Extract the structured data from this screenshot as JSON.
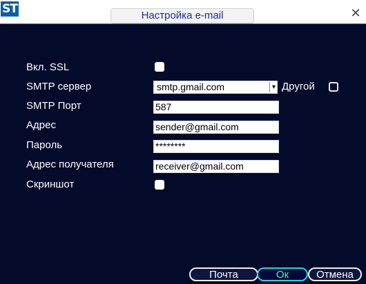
{
  "window": {
    "logo": "ST",
    "title": "Настройка e-mail",
    "close_glyph": "✕"
  },
  "form": {
    "ssl_label": "Вкл. SSL",
    "ssl_checked": true,
    "smtp_server_label": "SMTP сервер",
    "smtp_server_value": "smtp.gmail.com",
    "other_label": "Другой",
    "other_checked": false,
    "smtp_port_label": "SMTP Порт",
    "smtp_port_value": "587",
    "address_label": "Адрес",
    "address_value": "sender@gmail.com",
    "password_label": "Пароль",
    "password_value": "********",
    "recipient_label": "Адрес получателя",
    "recipient_value": "receiver@gmail.com",
    "screenshot_label": "Скриншот",
    "screenshot_checked": true
  },
  "buttons": {
    "mail": "Почта",
    "ok": "Ок",
    "cancel": "Отмена"
  },
  "colors": {
    "background": "#040a2a",
    "title": "#1a2ab0",
    "ok_border": "#20d9d9",
    "ok_text": "#33ffb0"
  },
  "icons": {
    "combo_arrow": "dropdown-arrow-icon",
    "close": "close-icon"
  }
}
